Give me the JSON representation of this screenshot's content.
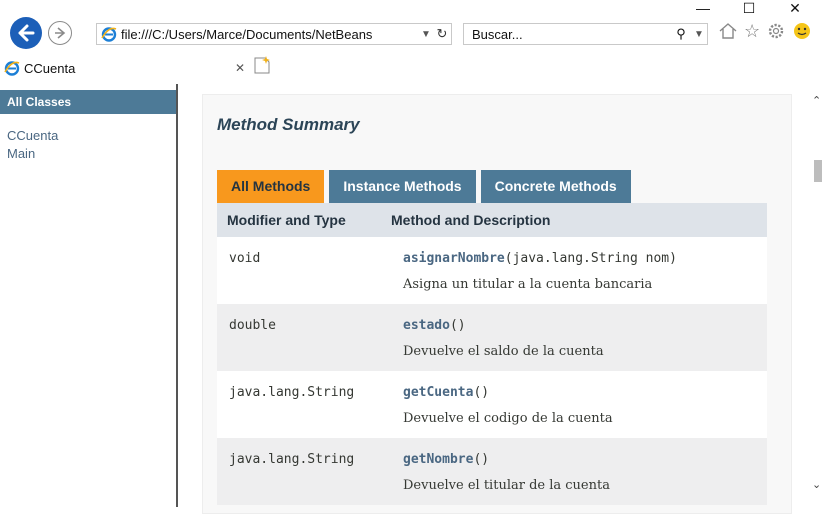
{
  "browser": {
    "address_url": "file:///C:/Users/Marce/Documents/NetBeans",
    "search_placeholder": "Buscar...",
    "tab_title": "CCuenta",
    "window_controls": [
      "minimize-icon",
      "maximize-icon",
      "close-icon"
    ],
    "toolbar_icons": [
      "home-icon",
      "star-icon",
      "gear-icon",
      "smiley-icon"
    ]
  },
  "left_frame": {
    "header": "All Classes",
    "classes": [
      "CCuenta",
      "Main"
    ]
  },
  "content": {
    "section_title": "Method Summary",
    "tabs": [
      {
        "label": "All Methods",
        "active": true
      },
      {
        "label": "Instance Methods",
        "active": false
      },
      {
        "label": "Concrete Methods",
        "active": false
      }
    ],
    "columns": [
      "Modifier and Type",
      "Method and Description"
    ],
    "methods": [
      {
        "type": "void",
        "name": "asignarNombre",
        "params": "(java.lang.String nom)",
        "description": "Asigna un titular a la cuenta bancaria"
      },
      {
        "type": "double",
        "name": "estado",
        "params": "()",
        "description": "Devuelve el saldo de la cuenta"
      },
      {
        "type": "java.lang.String",
        "name": "getCuenta",
        "params": "()",
        "description": "Devuelve el codigo de la cuenta"
      },
      {
        "type": "java.lang.String",
        "name": "getNombre",
        "params": "()",
        "description": "Devuelve el titular de la cuenta"
      }
    ]
  },
  "colors": {
    "header_blue": "#4d7a97",
    "active_tab_orange": "#f8981d",
    "table_header": "#dee3e9",
    "link": "#4a6782"
  }
}
